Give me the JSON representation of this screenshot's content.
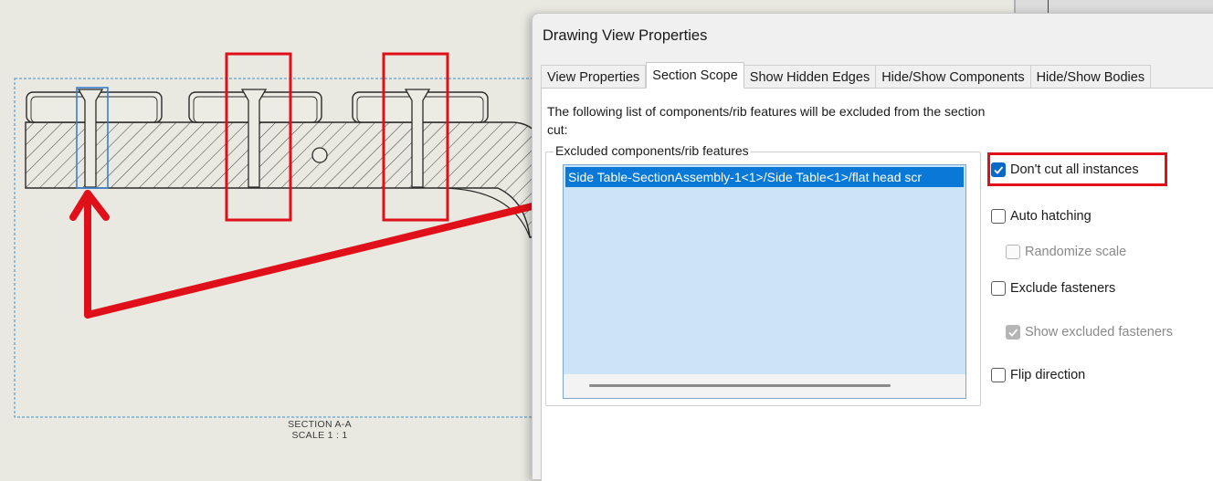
{
  "drawing": {
    "section_title": "SECTION A-A",
    "section_scale": "SCALE 1 : 1"
  },
  "dialog": {
    "title": "Drawing View Properties",
    "tabs": [
      {
        "label": "View Properties",
        "active": false
      },
      {
        "label": "Section Scope",
        "active": true
      },
      {
        "label": "Show Hidden Edges",
        "active": false
      },
      {
        "label": "Hide/Show Components",
        "active": false
      },
      {
        "label": "Hide/Show Bodies",
        "active": false
      }
    ],
    "info_text": "The following list of components/rib features will be excluded from the section cut:",
    "group_label": "Excluded components/rib features",
    "excluded_items": [
      "Side Table-SectionAssembly-1<1>/Side Table<1>/flat head scr"
    ],
    "options": {
      "dont_cut_all_instances": {
        "label": "Don't cut all instances",
        "checked": true
      },
      "auto_hatching": {
        "label": "Auto hatching",
        "checked": false
      },
      "randomize_scale": {
        "label": "Randomize scale",
        "checked": false,
        "disabled": true
      },
      "exclude_fasteners": {
        "label": "Exclude fasteners",
        "checked": false
      },
      "show_excluded_fasteners": {
        "label": "Show excluded fasteners",
        "checked": true,
        "disabled": true
      },
      "flip_direction": {
        "label": "Flip direction",
        "checked": false
      }
    }
  },
  "colors": {
    "annotation_red": "#e0101a",
    "selection_blue": "#0a78d7",
    "list_background": "#cce4f7",
    "checkbox_blue": "#0a68c8"
  }
}
